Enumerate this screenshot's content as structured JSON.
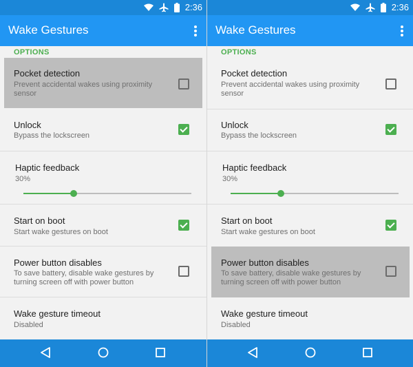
{
  "status_bar": {
    "time": "2:36",
    "wifi_icon": "wifi-icon",
    "airplane_icon": "airplane-icon",
    "battery_icon": "battery-icon"
  },
  "app_bar": {
    "title": "Wake Gestures",
    "menu_icon": "overflow-menu-icon"
  },
  "section_header": "OPTIONS",
  "settings": {
    "pocket_detection": {
      "title": "Pocket detection",
      "summary": "Prevent accidental wakes using proximity sensor",
      "checked": false
    },
    "unlock": {
      "title": "Unlock",
      "summary": "Bypass the lockscreen",
      "checked": true
    },
    "haptic_feedback": {
      "title": "Haptic feedback",
      "value_label": "30%",
      "value": 0.3
    },
    "start_on_boot": {
      "title": "Start on boot",
      "summary": "Start wake gestures on boot",
      "checked": true
    },
    "power_button_disables": {
      "title": "Power button disables",
      "summary": "To save battery, disable wake gestures by turning screen off with power button",
      "checked": false
    },
    "wake_gesture_timeout": {
      "title": "Wake gesture timeout",
      "summary": "Disabled"
    }
  },
  "screens": [
    {
      "highlighted": "pocket_detection"
    },
    {
      "highlighted": "power_button_disables"
    }
  ],
  "nav_bar": {
    "back_icon": "back-icon",
    "home_icon": "home-icon",
    "recents_icon": "recents-icon"
  },
  "colors": {
    "status_bar": "#1b87d8",
    "app_bar": "#2196f3",
    "accent": "#4caf50",
    "highlight": "#bdbdbd",
    "background": "#f2f2f2"
  }
}
